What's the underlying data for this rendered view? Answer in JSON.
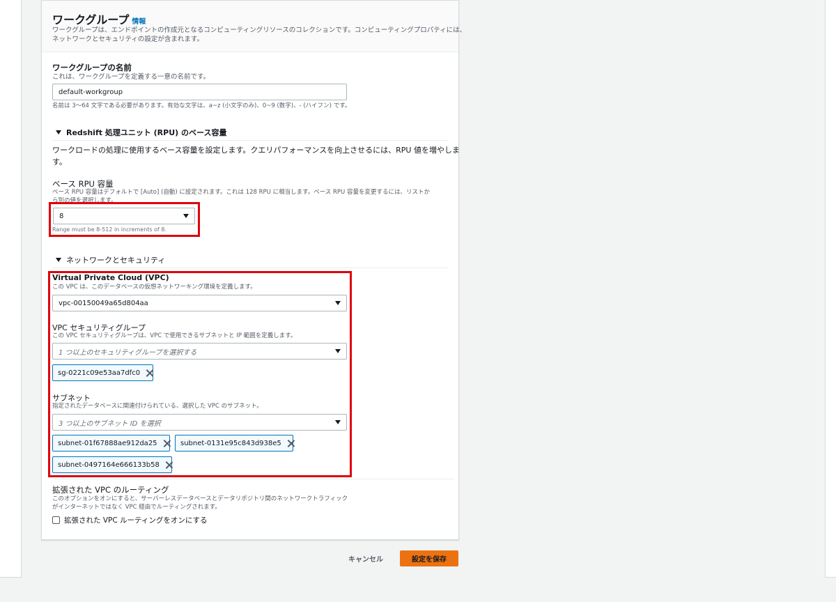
{
  "header": {
    "title": "ワークグループ",
    "info_link": "情報",
    "description_line1": "ワークグループは、エンドポイントの作成元となるコンピューティングリソースのコレクションです。コンピューティングプロパティには、",
    "description_line2": "ネットワークとセキュリティの設定が含まれます。"
  },
  "workgroup_name": {
    "label": "ワークグループの名前",
    "description": "これは、ワークグループを定義する一意の名前です。",
    "value": "default-workgroup",
    "constraint": "名前は 3～64 文字である必要があります。有効な文字は、a~z (小文字のみ)、0~9 (数字)、- (ハイフン) です。"
  },
  "rpu_section": {
    "heading": "Redshift 処理ユニット (RPU) のベース容量",
    "description_line1": "ワークロードの処理に使用するベース容量を設定します。クエリパフォーマンスを向上させるには、RPU 値を増やしま",
    "description_line2": "す。",
    "base_label": "ベース RPU 容量",
    "base_description_line1": "ベース RPU 容量はデフォルトで [Auto] (自動) に設定されます。これは 128 RPU に相当します。ベース RPU 容量を変更するには、リストか",
    "base_description_line2": "ら別の値を選択します。",
    "selected_value": "8",
    "range_hint": "Range must be 8-512 in increments of 8."
  },
  "network_section": {
    "heading": "ネットワークとセキュリティ",
    "vpc": {
      "label": "Virtual Private Cloud (VPC)",
      "description": "この VPC は、このデータベースの仮想ネットワーキング環境を定義します。",
      "selected_value": "vpc-00150049a65d804aa"
    },
    "security_group": {
      "label": "VPC セキュリティグループ",
      "description": "この VPC セキュリティグループは、VPC で使用できるサブネットと IP 範囲を定義します。",
      "placeholder": "1 つ以上のセキュリティグループを選択する",
      "tokens": [
        "sg-0221c09e53aa7dfc0"
      ]
    },
    "subnet": {
      "label": "サブネット",
      "description": "指定されたデータベースに関連付けられている、選択した VPC のサブネット。",
      "placeholder_prefix": "3 つ以上のサブネット ",
      "placeholder_em": "ID",
      "placeholder_suffix": " を選択",
      "tokens": [
        "subnet-01f67888ae912da25",
        "subnet-0131e95c843d938e5",
        "subnet-0497164e666133b58"
      ]
    }
  },
  "enhanced_vpc": {
    "label": "拡張された VPC のルーティング",
    "description_line1": "このオプションをオンにすると、サーバーレスデータベースとデータリポジトリ間のネットワークトラフィック",
    "description_line2": "がインターネットではなく VPC 経由でルーティングされます。",
    "checkbox_label": "拡張された VPC ルーティングをオンにする",
    "checked": false
  },
  "footer": {
    "cancel_label": "キャンセル",
    "save_label": "設定を保存"
  },
  "colors": {
    "primary_button": "#ec7211",
    "highlight_box": "#e0000b",
    "link": "#0073bb",
    "token_border": "#0073bb"
  }
}
